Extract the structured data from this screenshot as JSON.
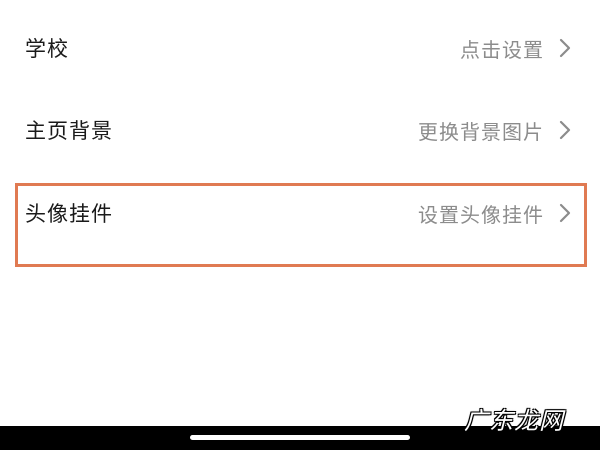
{
  "settings": {
    "rows": [
      {
        "label": "学校",
        "value": "点击设置"
      },
      {
        "label": "主页背景",
        "value": "更换背景图片"
      },
      {
        "label": "头像挂件",
        "value": "设置头像挂件"
      }
    ]
  },
  "icons": {
    "chevron": "chevron-right-icon"
  },
  "colors": {
    "highlight_border": "#e07a52",
    "label_text": "#1a1a1a",
    "value_text": "#8c8c8c"
  },
  "watermark": {
    "text": "广东龙网"
  }
}
